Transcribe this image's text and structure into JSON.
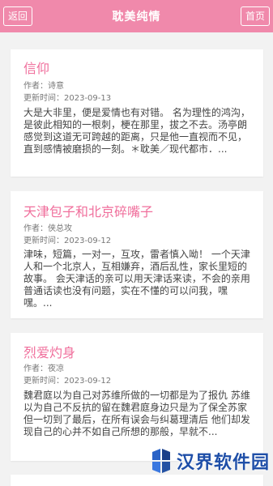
{
  "header": {
    "back_label": "返回",
    "title": "耽美纯情",
    "home_label": "首页"
  },
  "stories": [
    {
      "title": "信仰",
      "author": "作者：诗意",
      "updated": "更新时间：2023-09-13",
      "excerpt": "大是大非里，便是爱情也有对错。 名为理性的鸿沟，是彼此相知的一根刺，梗在那里，拔之不去。汤亭朗感觉到这道无可跨越的距离，只是他一直视而不见，直到感情被磨损的一刻。＊耽美／现代都市．..."
    },
    {
      "title": "天津包子和北京碎嘴子",
      "author": "作者：侠总攻",
      "updated": "更新时间：2023-09-12",
      "excerpt": "津味，短篇，一对一，互攻，雷者慎入呦！ 一个天津人和一个北京人，互相嫌弃，酒后乱性，家长里短的故事。 会天津话的亲可以用天津话来读，不会的亲用普通话读也没有问题，实在不懂的可以问我，嘿嘿。..."
    },
    {
      "title": "烈爱灼身",
      "author": "作者：夜凉",
      "updated": "更新时间：2023-09-12",
      "excerpt": "魏君庭以为自己对苏维所做的一切都是为了报仇 苏维以为自己不反抗的留在魏君庭身边只是为了保全苏家 但一切到了最后，在所有误会与纠葛理清后 他们却发现自己的心并不如自己所想的那般，早就不..."
    }
  ],
  "watermark": {
    "text": "汉界软件园",
    "color": "#1f4fa8"
  },
  "colors": {
    "accent": "#f089ab",
    "title": "#f06f9c",
    "background": "#f2f2f2"
  }
}
